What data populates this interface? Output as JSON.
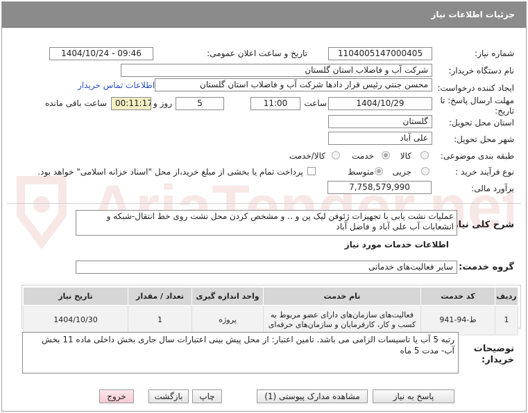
{
  "window_title": "جزئیات اطلاعات نیاز",
  "watermark_text": "AriaTender.net",
  "fields": {
    "need_number_label": "شماره نیاز:",
    "need_number": "1104005147000405",
    "announce_label": "تاریخ و ساعت اعلان عمومی:",
    "announce_value": "1404/10/24 - 09:46",
    "buyer_org_label": "نام دستگاه خریدار:",
    "buyer_org": "شرکت آب و فاضلاب استان گلستان",
    "creator_label": "ایجاد کننده درخواست:",
    "creator": "محسن جنتي رئیس قرار دادها شرکت آب و فاضلاب استان گلستان",
    "contact_link": "اطلاعات تماس خریدار",
    "deadline_label": "مهلت ارسال پاسخ: تا تاریخ:",
    "deadline_date": "1404/10/29",
    "time_label": "ساعت",
    "deadline_time": "11:00",
    "days_value": "5",
    "days_label": "روز و",
    "remaining_time": "00:11:17",
    "remaining_label": "ساعت باقی مانده",
    "province_label": "استان محل تحویل:",
    "province": "گلستان",
    "city_label": "شهر محل تحویل:",
    "city": "علی آباد",
    "category_label": "طبقه بندی موضوعی:",
    "category_options": [
      "کالا",
      "خدمت",
      "کالا/خدمت"
    ],
    "category_selected": "خدمت",
    "purchase_type_label": "نوع فرآیند خرید :",
    "purchase_options": [
      "جزیی",
      "متوسط"
    ],
    "purchase_selected": "متوسط",
    "payment_note": "پرداخت تمام یا بخشی از مبلغ خرید،از محل \"اسناد خزانه اسلامی\" خواهد بود.",
    "estimate_label": "برآورد مالی:",
    "estimate_value": "7,758,579,990"
  },
  "description": {
    "label": "شرح کلی نیاز:",
    "text": "عملیات نشت یابی با تجهیزات ژئوفن لیک پن و .. و مشخص کردن محل نشت روی خط انتقال-شبکه و انشعابات آب علی آباد و فاضل آباد"
  },
  "services_section": {
    "title": "اطلاعات خدمات مورد نیاز",
    "group_label": "گروه خدمت:",
    "group_value": "سایر فعالیت‌های خدماتی"
  },
  "table": {
    "headers": [
      "ردیف",
      "کد خدمت",
      "نام خدمت",
      "واحد اندازه گیری",
      "تعداد / مقدار",
      "تاریخ نیاز"
    ],
    "rows": [
      [
        "1",
        "ط-94-941",
        "فعالیت‌های سازمان‌های دارای عضو مربوط به کسب و کار، کارفرمایان و سازمان‌های حرفه‌ای",
        "پروژه",
        "1",
        "1404/10/30"
      ]
    ]
  },
  "buyer_notes": {
    "label": "توضیحات خریدار:",
    "text": "رتبه 5 آب یا تاسیسات الزامی می باشد. تامین اعتبار: از محل پیش بینی اعتبارات سال جاری بخش داخلی ماده 11 بخش آب- مدت 5 ماه"
  },
  "buttons": {
    "reply": "پاسخ به نیاز",
    "attachments": "مشاهده مدارک پیوستی (1)",
    "print": "چاپ",
    "back": "بازگشت",
    "exit": "خروج"
  }
}
